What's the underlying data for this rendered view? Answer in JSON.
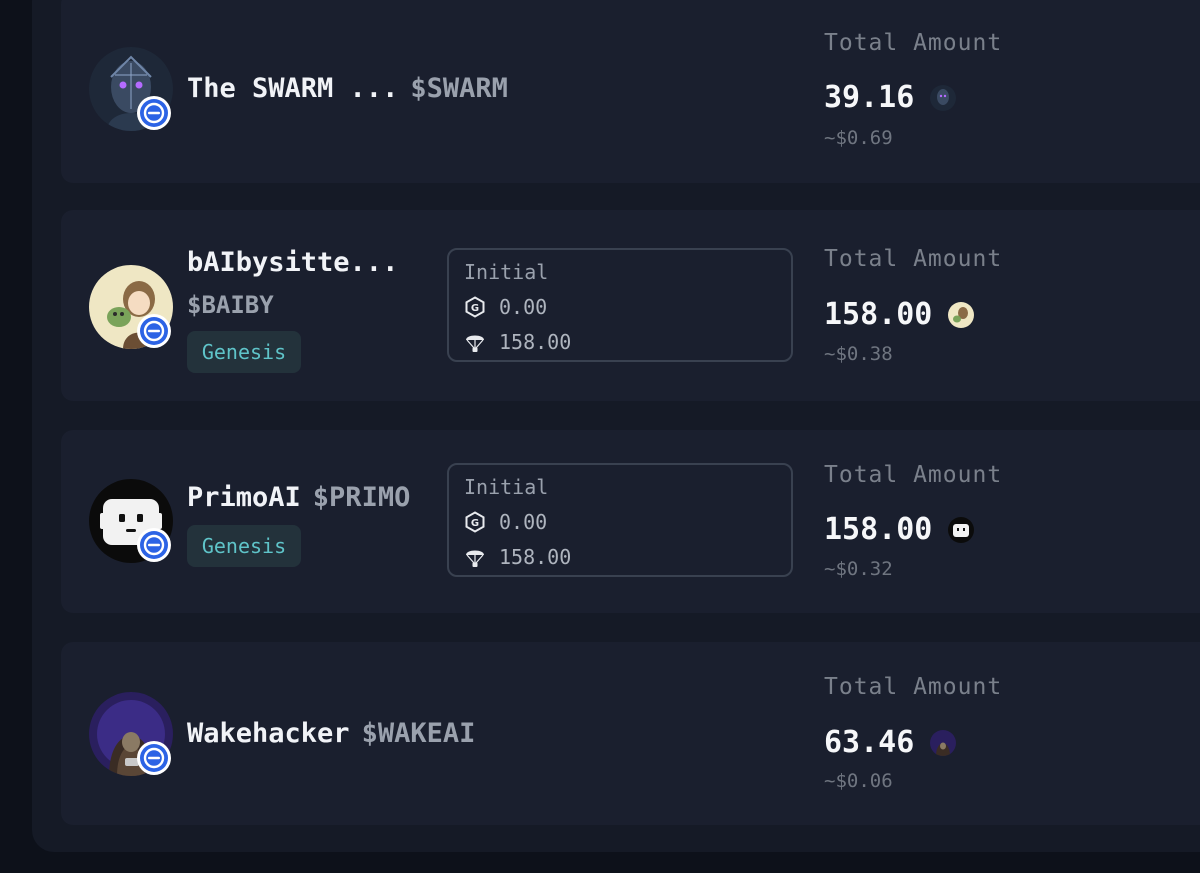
{
  "total_amount_label": "Total Amount",
  "initial_label": "Initial",
  "genesis_label": "Genesis",
  "colors": {
    "background": "#0d111a",
    "panel": "#151a26",
    "card": "#1a1f2e",
    "genesis_text": "#5fc4c9",
    "badge_blue": "#2c63e5"
  },
  "icons": {
    "badge": "minus-circle-icon",
    "initial_first": "g-hexagon-icon",
    "initial_second": "parachute-icon"
  },
  "tokens": [
    {
      "name": "The SWARM ...",
      "ticker": "$SWARM",
      "total_amount": "39.16",
      "usd_value": "~$0.69"
    },
    {
      "name": "bAIbysitte...",
      "ticker": "$BAIBY",
      "genesis": true,
      "initial": {
        "g_amount": "0.00",
        "airdrop_amount": "158.00"
      },
      "total_amount": "158.00",
      "usd_value": "~$0.38"
    },
    {
      "name": "PrimoAI",
      "ticker": "$PRIMO",
      "genesis": true,
      "initial": {
        "g_amount": "0.00",
        "airdrop_amount": "158.00"
      },
      "total_amount": "158.00",
      "usd_value": "~$0.32"
    },
    {
      "name": "Wakehacker",
      "ticker": "$WAKEAI",
      "total_amount": "63.46",
      "usd_value": "~$0.06"
    }
  ]
}
